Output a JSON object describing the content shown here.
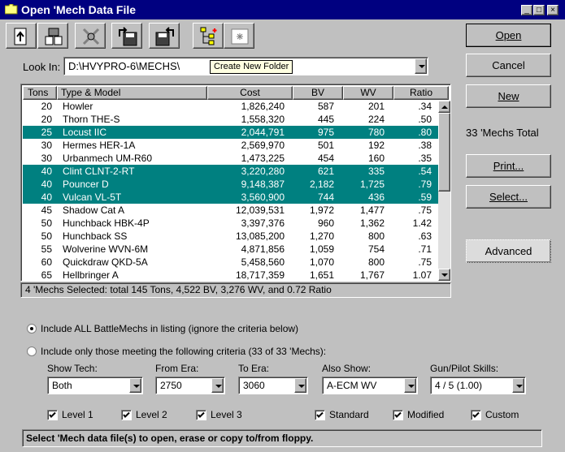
{
  "window": {
    "title": "Open 'Mech Data File",
    "minimize": "_",
    "maximize": "□",
    "close": "×"
  },
  "toolbar": [
    "open-file-icon",
    "compare-icon",
    "destroy-icon",
    "copy-to-floppy-icon",
    "copy-from-floppy-icon",
    "tree-view-icon",
    "new-folder-icon"
  ],
  "lookin": {
    "label": "Look In:",
    "path": "D:\\HVYPRO-6\\MECHS\\",
    "tooltip": "Create New Folder"
  },
  "columns": [
    "Tons",
    "Type & Model",
    "Cost",
    "BV",
    "WV",
    "Ratio"
  ],
  "rows": [
    {
      "tons": "20",
      "model": "Howler",
      "cost": "1,826,240",
      "bv": "587",
      "wv": "201",
      "ratio": ".34",
      "selected": false
    },
    {
      "tons": "20",
      "model": "Thorn THE-S",
      "cost": "1,558,320",
      "bv": "445",
      "wv": "224",
      "ratio": ".50",
      "selected": false
    },
    {
      "tons": "25",
      "model": "Locust IIC",
      "cost": "2,044,791",
      "bv": "975",
      "wv": "780",
      "ratio": ".80",
      "selected": true
    },
    {
      "tons": "30",
      "model": "Hermes HER-1A",
      "cost": "2,569,970",
      "bv": "501",
      "wv": "192",
      "ratio": ".38",
      "selected": false
    },
    {
      "tons": "30",
      "model": "Urbanmech UM-R60",
      "cost": "1,473,225",
      "bv": "454",
      "wv": "160",
      "ratio": ".35",
      "selected": false
    },
    {
      "tons": "40",
      "model": "Clint CLNT-2-RT",
      "cost": "3,220,280",
      "bv": "621",
      "wv": "335",
      "ratio": ".54",
      "selected": true
    },
    {
      "tons": "40",
      "model": "Pouncer D",
      "cost": "9,148,387",
      "bv": "2,182",
      "wv": "1,725",
      "ratio": ".79",
      "selected": true
    },
    {
      "tons": "40",
      "model": "Vulcan VL-5T",
      "cost": "3,560,900",
      "bv": "744",
      "wv": "436",
      "ratio": ".59",
      "selected": true
    },
    {
      "tons": "45",
      "model": "Shadow Cat A",
      "cost": "12,039,531",
      "bv": "1,972",
      "wv": "1,477",
      "ratio": ".75",
      "selected": false
    },
    {
      "tons": "50",
      "model": "Hunchback HBK-4P",
      "cost": "3,397,376",
      "bv": "960",
      "wv": "1,362",
      "ratio": "1.42",
      "selected": false
    },
    {
      "tons": "50",
      "model": "Hunchback SS",
      "cost": "13,085,200",
      "bv": "1,270",
      "wv": "800",
      "ratio": ".63",
      "selected": false
    },
    {
      "tons": "55",
      "model": "Wolverine WVN-6M",
      "cost": "4,871,856",
      "bv": "1,059",
      "wv": "754",
      "ratio": ".71",
      "selected": false
    },
    {
      "tons": "60",
      "model": "Quickdraw QKD-5A",
      "cost": "5,458,560",
      "bv": "1,070",
      "wv": "800",
      "ratio": ".75",
      "selected": false
    },
    {
      "tons": "65",
      "model": "Hellbringer A",
      "cost": "18,717,359",
      "bv": "1,651",
      "wv": "1,767",
      "ratio": "1.07",
      "selected": false
    }
  ],
  "summary": "4 'Mechs Selected: total 145 Tons,  4,522 BV,  3,276 WV, and  0.72 Ratio",
  "buttons": {
    "open": "Open",
    "cancel": "Cancel",
    "new": "New",
    "print": "Print...",
    "select": "Select...",
    "advanced": "Advanced"
  },
  "total": "33 'Mechs Total",
  "options": {
    "include_all": "Include ALL BattleMechs in listing (ignore the criteria below)",
    "include_some": "Include only those meeting the following criteria (33 of 33 'Mechs):"
  },
  "filters": [
    {
      "label": "Show Tech:",
      "value": "Both"
    },
    {
      "label": "From Era:",
      "value": "2750"
    },
    {
      "label": "To Era:",
      "value": "3060"
    },
    {
      "label": "Also Show:",
      "value": "A-ECM WV"
    },
    {
      "label": "Gun/Pilot Skills:",
      "value": "4 / 5  (1.00)"
    }
  ],
  "checks": [
    {
      "label": "Level 1",
      "checked": true
    },
    {
      "label": "Level 2",
      "checked": true
    },
    {
      "label": "Level 3",
      "checked": true
    },
    {
      "label": "Standard",
      "checked": true
    },
    {
      "label": "Modified",
      "checked": true
    },
    {
      "label": "Custom",
      "checked": true
    }
  ],
  "status": "Select 'Mech data file(s) to open, erase or copy to/from floppy.",
  "colors": {
    "title_bar": "#000080",
    "selection": "#008080",
    "face": "#c0c0c0"
  }
}
